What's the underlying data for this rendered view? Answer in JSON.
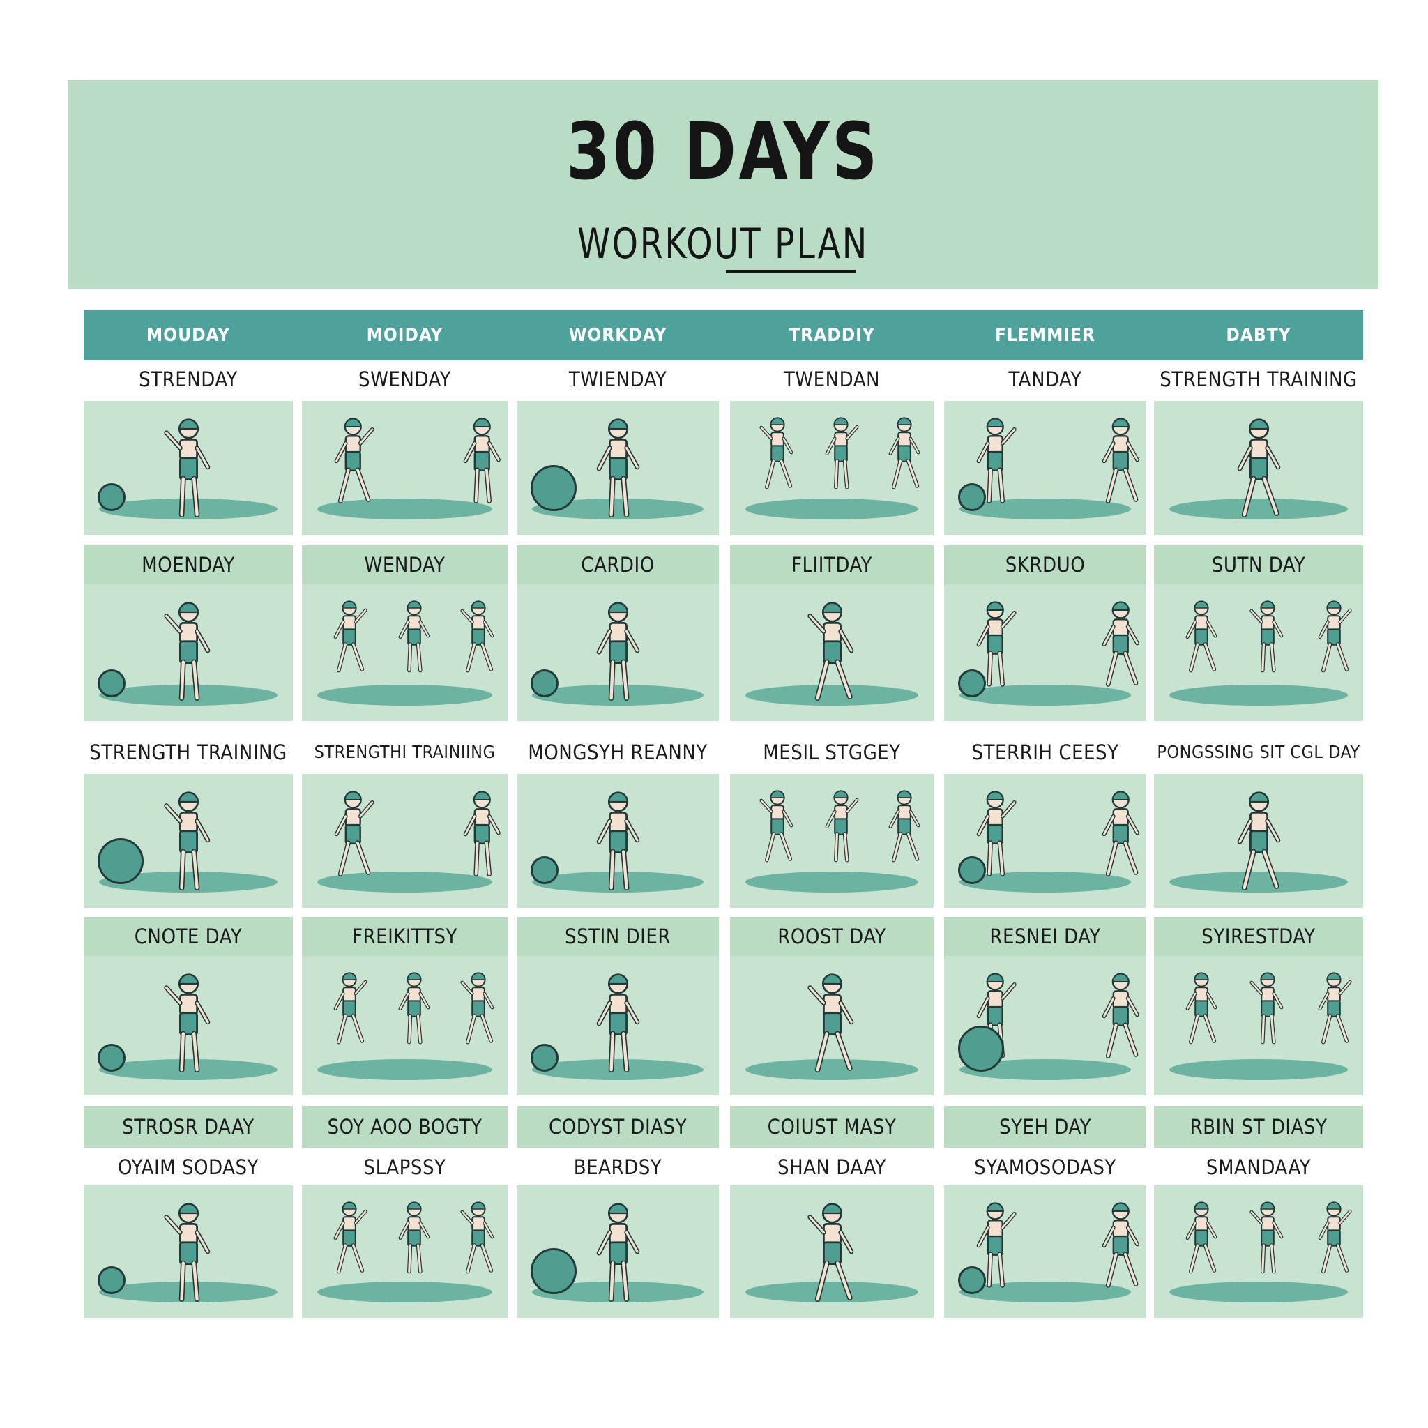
{
  "title": "30  DAYS",
  "subtitle": "WORKOUT PLAN",
  "colors": {
    "banner": "#b8dcc4",
    "header": "#4fa19c",
    "tile": "#c8e3d0",
    "accent": "#62ad9b"
  },
  "header_days": [
    "MOUDAY",
    "MOIDAY",
    "WORKDAY",
    "TRADDIY",
    "FLEMMIER",
    "DABTY"
  ],
  "rows": [
    {
      "labels": [
        "STRENDAY",
        "SWENDAY",
        "TWIENDAY",
        "TWENDAN",
        "TANDAY",
        "STRENGTH TRAINING"
      ]
    },
    {
      "labels": [
        "MOENDAY",
        "WENDAY",
        "CARDIO",
        "FLIITDAY",
        "SKRDUO",
        "SUTN DAY"
      ]
    },
    {
      "labels": [
        "STRENGTH TRAINING",
        "STRENGTHI TRAINIING",
        "MONGSYH REANNY",
        "MESIL STGGEY",
        "STERRIH CEESY",
        "PONGSSING SIT CGL DAY"
      ]
    },
    {
      "labels": [
        "CNOTE DAY",
        "FREIKITTSY",
        "SSTIN DIER",
        "ROOST DAY",
        "RESNEI DAY",
        "SYIRESTDAY"
      ]
    },
    {
      "labels": [
        "STROSR DAAY",
        "SOY AOO BOGTY",
        "CODYST DIASY",
        "COIUST MASY",
        "SYEH DAY",
        "RBIN ST DIASY"
      ]
    },
    {
      "labels": [
        "OYAIM SODASY",
        "SLAPSSY",
        "BEARDSY",
        "SHAN DAAY",
        "SYAMOSODASY",
        "SMANDAAY"
      ]
    }
  ],
  "icons": {
    "exercise": "exercise-figure-icon",
    "ball": "medicine-ball-icon"
  }
}
